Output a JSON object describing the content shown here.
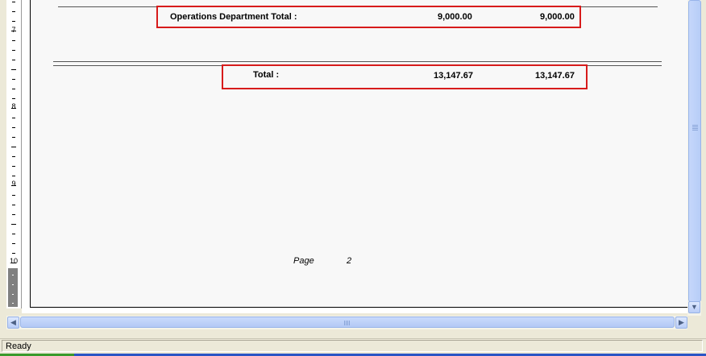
{
  "ruler": {
    "numbers": [
      "7",
      "8",
      "9",
      "10"
    ]
  },
  "report": {
    "dept_total": {
      "label": "Operations Department Total :",
      "value1": "9,000.00",
      "value2": "9,000.00"
    },
    "grand_total": {
      "label": "Total :",
      "value1": "13,147.67",
      "value2": "13,147.67"
    },
    "footer": {
      "page_label": "Page",
      "page_number": "2"
    }
  },
  "colors": {
    "highlight": "#d71b1b",
    "page_background": "#f8f8f8",
    "scrollbar_thumb": "#b9cdf7"
  },
  "statusbar": {
    "text": "Ready"
  }
}
